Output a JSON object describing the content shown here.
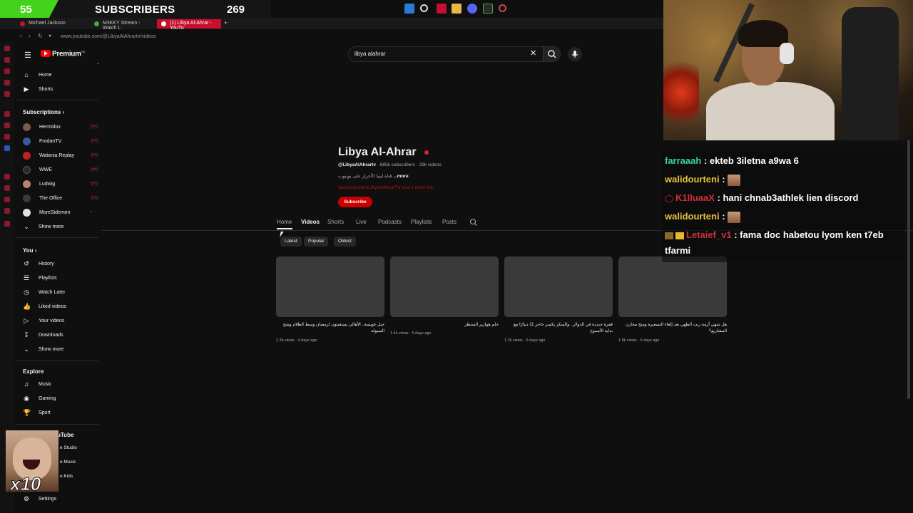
{
  "overlay": {
    "sub_count": "55",
    "sub_label": "SUBSCRIBERS",
    "sub_goal": "269"
  },
  "browser": {
    "tabs": [
      {
        "label": "Michael Jackson"
      },
      {
        "label": "M3KKY Stream - Watch L"
      },
      {
        "label": "(1) Libya Al-Ahrar - YouTu"
      }
    ],
    "new_tab": "+",
    "url": "www.youtube.com/@LibyaAlAhrartv/videos"
  },
  "youtube": {
    "brand": "Premium",
    "brand_sup": "TN",
    "search_value": "libya alahrar"
  },
  "sidebar": {
    "main": [
      {
        "label": "Home",
        "icon": "home-icon"
      },
      {
        "label": "Shorts",
        "icon": "shorts-icon"
      }
    ],
    "subscriptions_heading": "Subscriptions",
    "subscriptions": [
      {
        "label": "Hermidox",
        "color": "#7a5a4a"
      },
      {
        "label": "FrodanTV",
        "color": "#3a5aa0"
      },
      {
        "label": "Watania Replay",
        "color": "#c02020"
      },
      {
        "label": "WWE",
        "color": "#2a2a2a"
      },
      {
        "label": "Ludwig",
        "color": "#c08070"
      },
      {
        "label": "The Office",
        "color": "#3a3a3a"
      },
      {
        "label": "MoreSidemen",
        "color": "#e0e0e0"
      }
    ],
    "show_more_1": "Show more",
    "you_heading": "You",
    "you_items": [
      {
        "label": "History",
        "icon": "history-icon"
      },
      {
        "label": "Playlists",
        "icon": "playlists-icon"
      },
      {
        "label": "Watch Later",
        "icon": "watch-later-icon"
      },
      {
        "label": "Liked videos",
        "icon": "like-icon"
      },
      {
        "label": "Your videos",
        "icon": "your-videos-icon"
      },
      {
        "label": "Downloads",
        "icon": "download-icon"
      }
    ],
    "show_more_2": "Show more",
    "explore_heading": "Explore",
    "explore_items": [
      {
        "label": "Music",
        "icon": "music-icon"
      },
      {
        "label": "Gaming",
        "icon": "gaming-icon"
      },
      {
        "label": "Sport",
        "icon": "trophy-icon"
      }
    ],
    "more_from": "uTube",
    "more_items": [
      "e Studio",
      "e Music",
      "e Kids"
    ],
    "settings": "Settings"
  },
  "channel": {
    "name": "Libya Al-Ahrar",
    "handle": "@LibyaAlAhrartv",
    "meta": "· 685k subscribers · 29k videos",
    "desc": "قناة ليبيا الأحرار على يوتيوب",
    "desc_more": "...more",
    "link": "facebook.com/LibyaAlAhrarTV and 1 more link",
    "subscribe": "Subscribe",
    "tabs": [
      "Home",
      "Videos",
      "Shorts",
      "Live",
      "Podcasts",
      "Playlists",
      "Posts"
    ],
    "chips": [
      "Latest",
      "Popular",
      "Oldest"
    ]
  },
  "videos": [
    {
      "title": "جيل غويسة.. الأهالي يستغيثون لرمضان وسط الظلام وشح السيولة",
      "meta": "2.3k views · 4 days ago"
    },
    {
      "title": "حلم هوارير المنتظر",
      "meta": "1.4k views · 5 days ago"
    },
    {
      "title": "قفزة جديدة في الدولار.. والسكر يكسر حاجز 11 دينارًا مع بداية الأسبوع",
      "meta": "1.2k views · 5 days ago"
    },
    {
      "title": "هل تنتهي أزمة زيت الطهي بعد إلغاء التسعيرة ومنح مخازن المشاريع؟",
      "meta": "1.8k views · 5 days ago"
    }
  ],
  "chat": [
    {
      "user": "farraaah",
      "user_color": "#3ad3a0",
      "text": ": ekteb 3iletna a9wa 6"
    },
    {
      "user": "walidourteni",
      "user_color": "#e8c040",
      "text": ":",
      "emote": true
    },
    {
      "user": "K1lluaaX",
      "user_color": "#d0303a",
      "text": ": hani chnab3athlek lien discord"
    },
    {
      "user": "walidourteni",
      "user_color": "#e8c040",
      "text": ":",
      "emote": true
    },
    {
      "user": "Letaief_v1",
      "user_color": "#d0303a",
      "text": ": fama doc habetou lyom ken t7eb tfarmi"
    }
  ],
  "reaction": {
    "multiplier": "x10"
  }
}
